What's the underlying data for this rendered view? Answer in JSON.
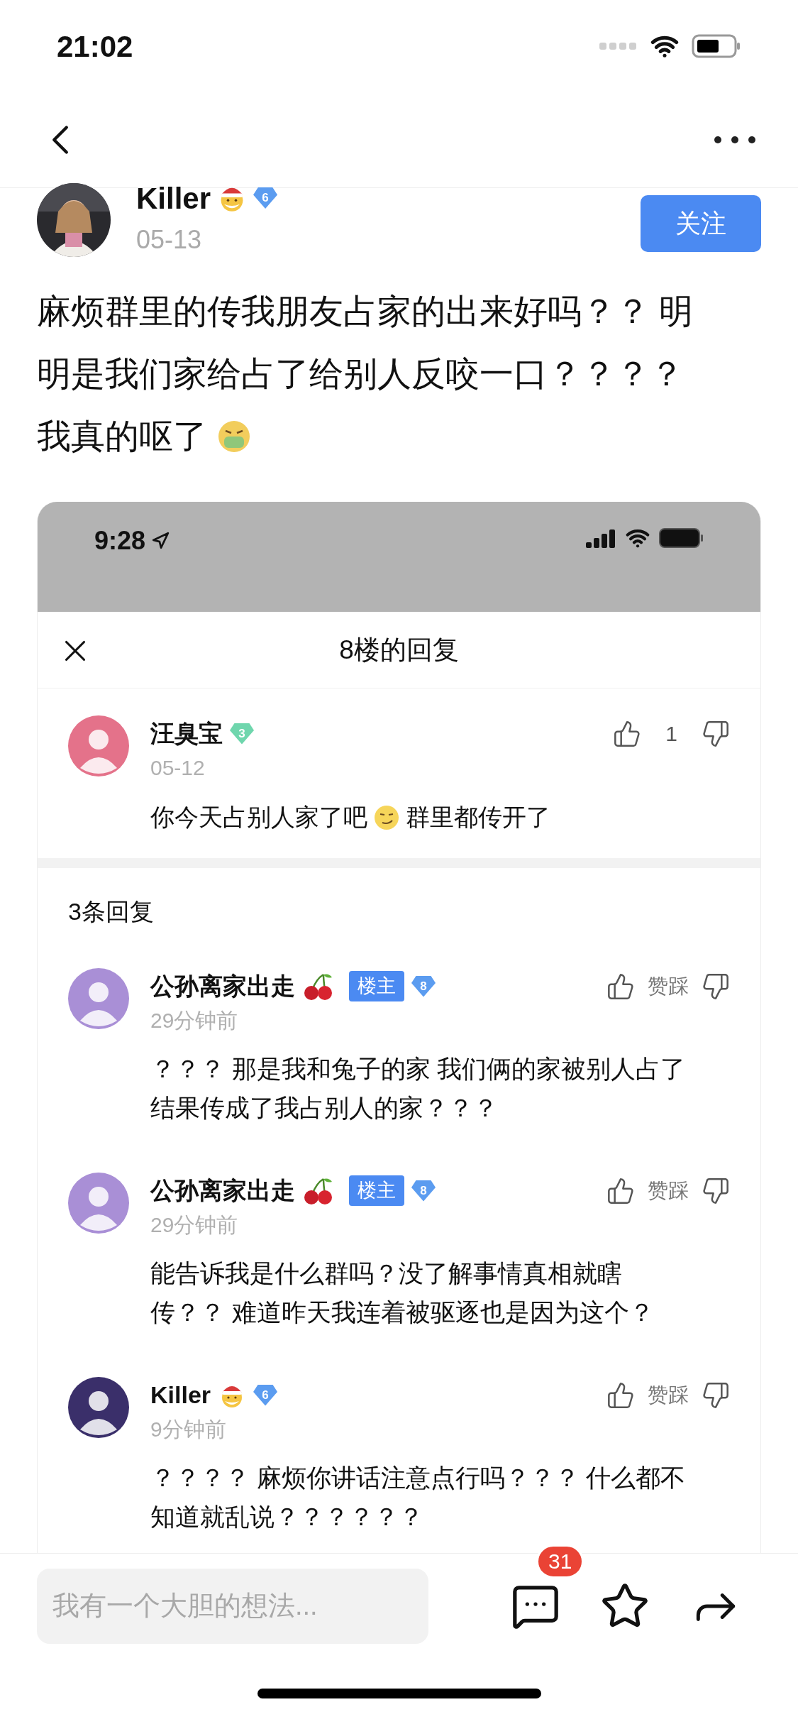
{
  "status_bar": {
    "time": "21:02"
  },
  "post": {
    "author": "Killer",
    "rank": {
      "text": "6",
      "color": "#5b9cf0"
    },
    "date": "05-13",
    "follow_label": "关注",
    "text": [
      "麻烦群里的传我朋友占家的出来好吗？？ 明明是我们家给占了给别人反咬一口？？？？",
      "我真的呕了"
    ]
  },
  "screenshot": {
    "status_time": "9:28",
    "panel_title": "8楼的回复",
    "comment": {
      "author": "汪臭宝",
      "rank": {
        "text": "3",
        "color": "#6fd6ad"
      },
      "date": "05-12",
      "likes": "1",
      "text": [
        "你今天占别人家了吧",
        "群里都传开了"
      ]
    },
    "reply_count": "3条回复",
    "replies": [
      {
        "kind": "owner",
        "author": "公孙离家出走",
        "badge": "楼主",
        "rank": {
          "text": "8",
          "color": "#5b9cf0"
        },
        "time": "29分钟前",
        "vote_label": "赞踩",
        "text": "？？？ 那是我和兔子的家 我们俩的家被别人占了结果传成了我占别人的家？？？"
      },
      {
        "kind": "owner",
        "author": "公孙离家出走",
        "badge": "楼主",
        "rank": {
          "text": "8",
          "color": "#5b9cf0"
        },
        "time": "29分钟前",
        "vote_label": "赞踩",
        "text": "能告诉我是什么群吗？没了解事情真相就瞎传？？ 难道昨天我连着被驱逐也是因为这个？"
      },
      {
        "kind": "member",
        "author": "Killer",
        "rank": {
          "text": "6",
          "color": "#5b9cf0"
        },
        "time": "9分钟前",
        "vote_label": "赞踩",
        "text": "？？？？ 麻烦你讲话注意点行吗？？？ 什么都不知道就乱说？？？？？？"
      }
    ]
  },
  "bottom_bar": {
    "placeholder": "我有一个大胆的想法...",
    "comment_count": "31"
  }
}
